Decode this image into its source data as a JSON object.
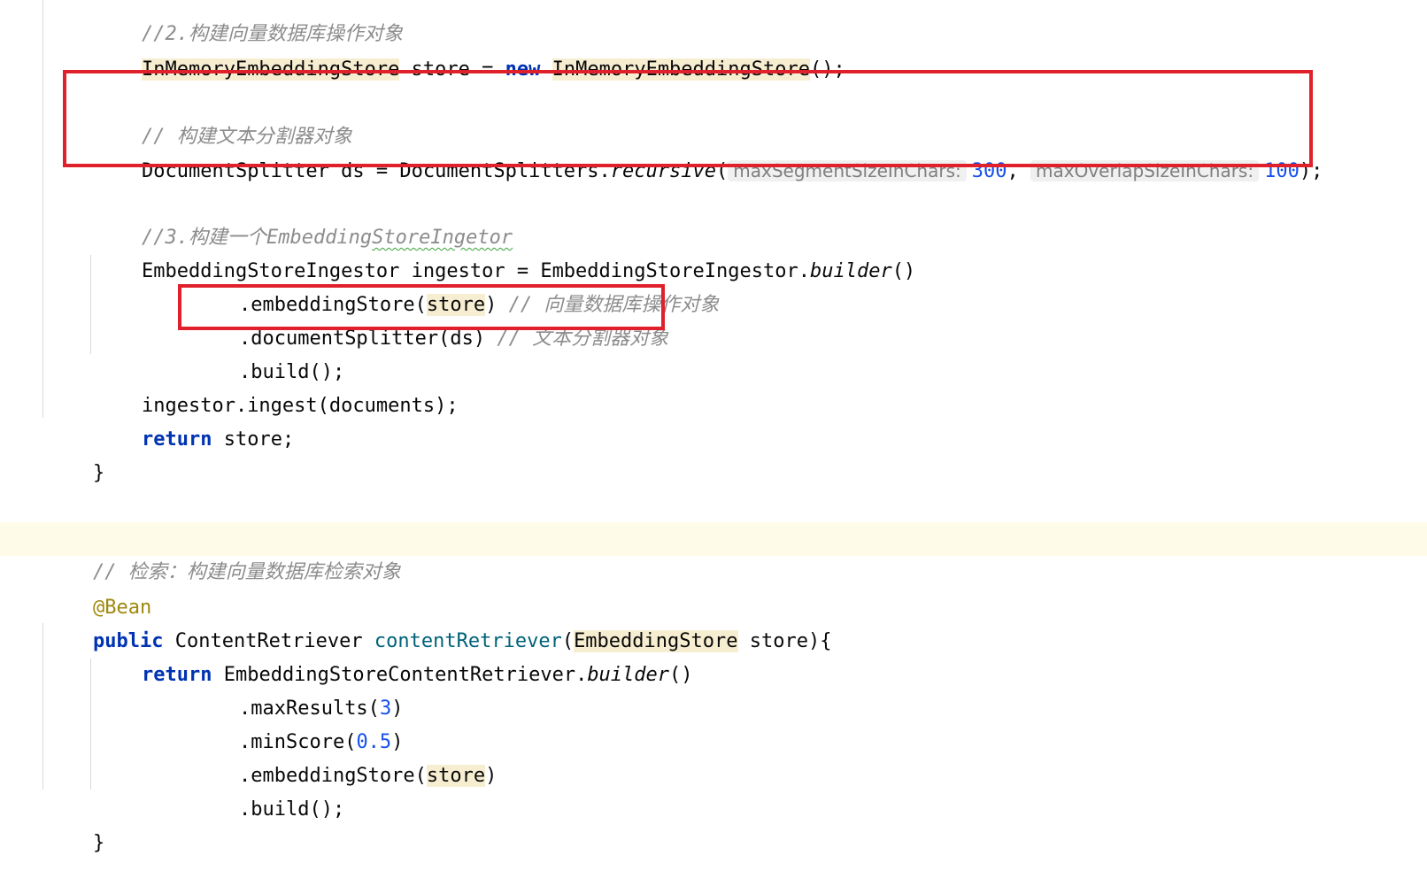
{
  "colors": {
    "keyword": "#0033b3",
    "number": "#1750eb",
    "comment": "#8c8c8c",
    "method_decl": "#00627a",
    "annotation": "#9e880d",
    "usage_highlight": "#f7eed2",
    "current_line": "#fefbe9",
    "callout_border": "#e0202a"
  },
  "code": {
    "l0": {
      "comment": "//2.构建向量数据库操作对象"
    },
    "l1": {
      "type": "InMemoryEmbeddingStore",
      "mid": " store = ",
      "kw_new": "new",
      "ctor": "InMemoryEmbeddingStore",
      "tail": "();"
    },
    "l2": {
      "comment": "// 构建文本分割器对象"
    },
    "l3": {
      "pre": "DocumentSplitter ds = DocumentSplitters.",
      "method": "recursive",
      "open": "(",
      "hint1": "maxSegmentSizeInChars:",
      "val1": "300",
      "sep": ", ",
      "hint2": "maxOverlapSizeInChars:",
      "val2": "100",
      "close": ");"
    },
    "l4": {
      "comment_a": "//3.构建一个Embedding",
      "comment_b": "StoreIngetor"
    },
    "l5": {
      "pre": "EmbeddingStoreIngestor ingestor = EmbeddingStoreIngestor.",
      "method": "builder",
      "tail": "()"
    },
    "l6": {
      "pre": ".embeddingStore(",
      "arg": "store",
      "close": ")",
      "comment": " // 向量数据库操作对象"
    },
    "l7": {
      "code": ".documentSplitter(ds)",
      "comment": " // 文本分割器对象"
    },
    "l8": {
      "code": ".build();"
    },
    "l9": {
      "code": "ingestor.ingest(documents);"
    },
    "l10": {
      "kw": "return",
      "rest": " store;"
    },
    "l11": {
      "code": "}"
    },
    "l12": {
      "comment": "// 检索：构建向量数据库检索对象"
    },
    "l13": {
      "annotation": "@Bean"
    },
    "l14": {
      "kw": "public",
      "type": " ContentRetriever ",
      "method": "contentRetriever",
      "open": "(",
      "param_type": "EmbeddingStore",
      "rest": " store){"
    },
    "l15": {
      "kw": "return",
      "pre": " EmbeddingStoreContentRetriever.",
      "method": "builder",
      "tail": "()"
    },
    "l16": {
      "pre": ".maxResults(",
      "num": "3",
      "close": ")"
    },
    "l17": {
      "pre": ".minScore(",
      "num": "0.5",
      "close": ")"
    },
    "l18": {
      "pre": ".embeddingStore(",
      "arg": "store",
      "close": ")"
    },
    "l19": {
      "code": ".build();"
    },
    "l20": {
      "code": "}"
    }
  }
}
